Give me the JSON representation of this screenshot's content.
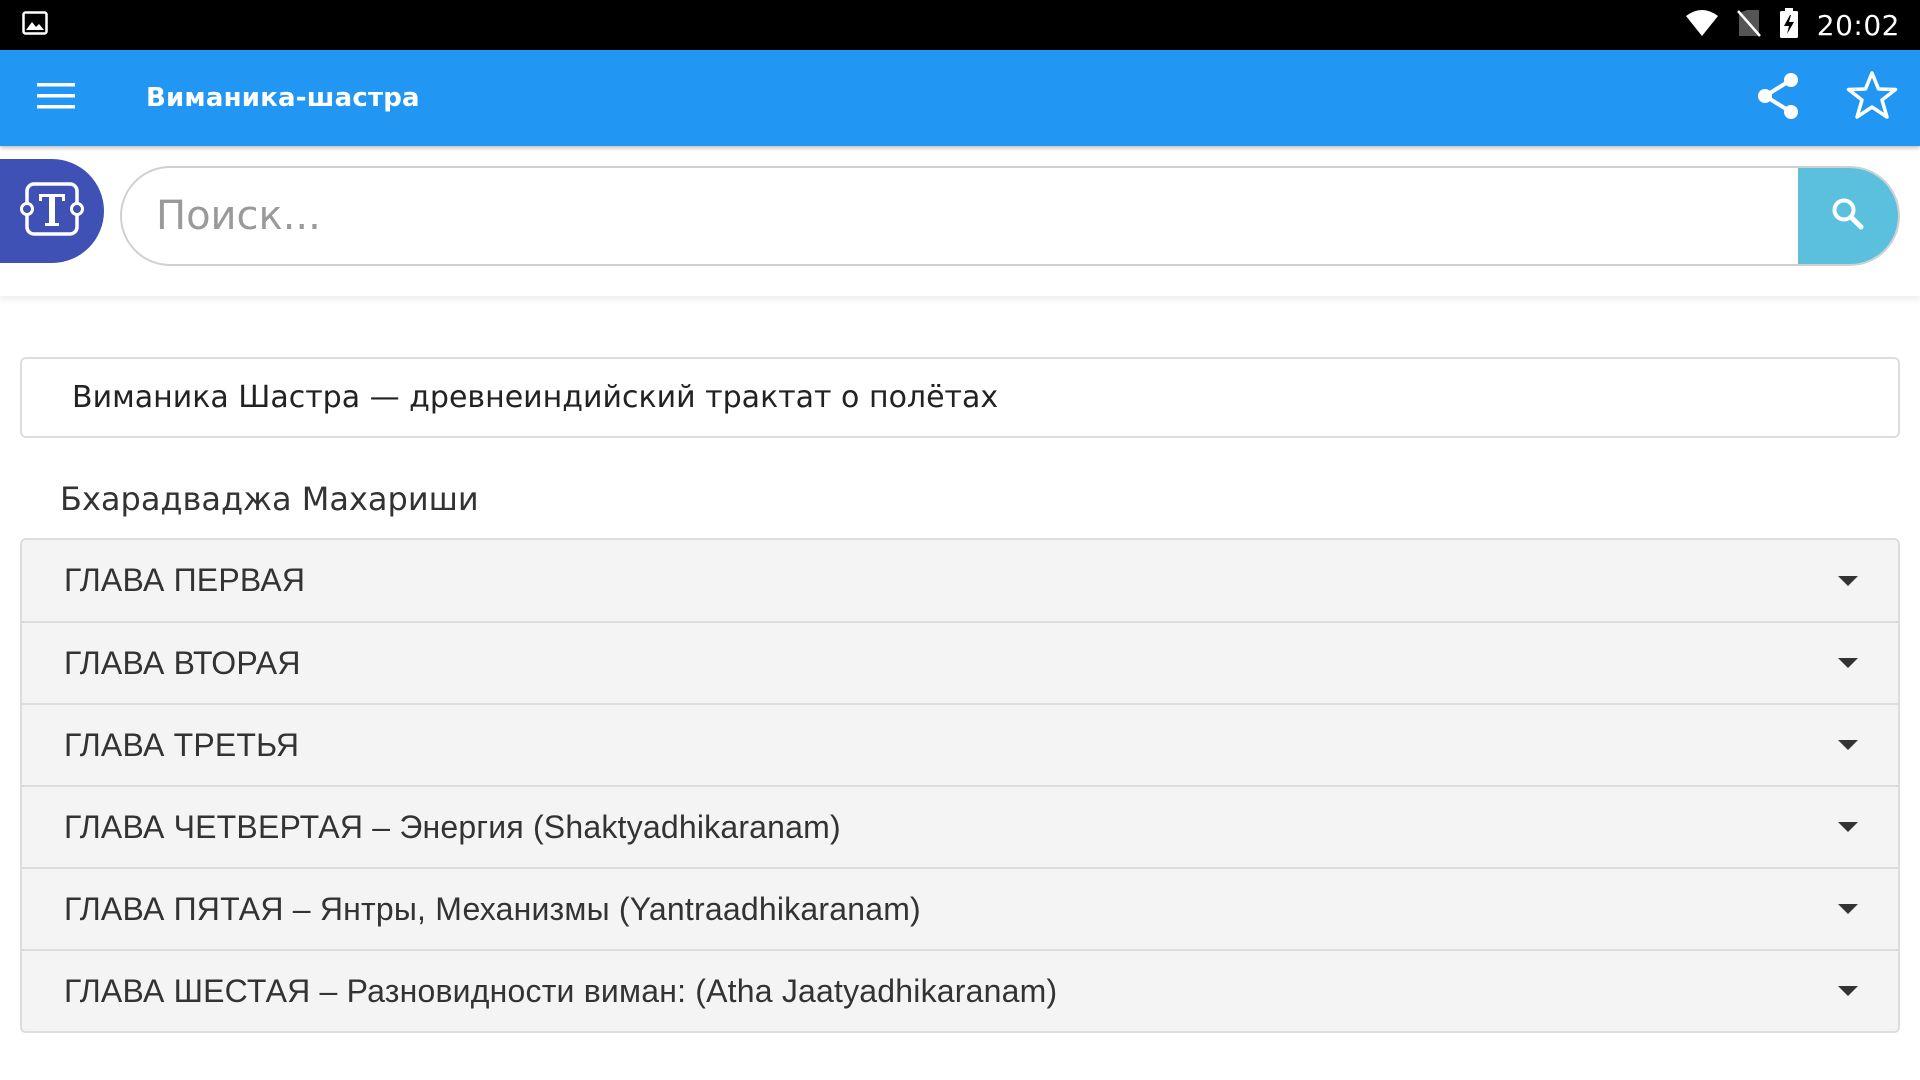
{
  "status_bar": {
    "time": "20:02",
    "icons": [
      "image-icon",
      "wifi-icon",
      "no-sim-icon",
      "battery-charging-icon"
    ]
  },
  "app_bar": {
    "title": "Виманика-шастра",
    "icons": [
      "menu-icon",
      "share-icon",
      "star-icon"
    ],
    "color": "#2196f3"
  },
  "search": {
    "placeholder": "Поиск...",
    "value": "",
    "button_color": "#5bc0de",
    "logo_color": "#3f51b5",
    "logo_icon": "text-tool-icon"
  },
  "content": {
    "heading": "Виманика Шастра — древнеиндийский трактат о полётах",
    "author": "Бхарадваджа Махариши",
    "chapters": [
      {
        "label": "ГЛАВА ПЕРВАЯ"
      },
      {
        "label": "ГЛАВА ВТОРАЯ"
      },
      {
        "label": "ГЛАВА ТРЕТЬЯ"
      },
      {
        "label": "ГЛАВА ЧЕТВЕРТАЯ – Энергия (Shaktyadhikaranam)"
      },
      {
        "label": "ГЛАВА ПЯТАЯ – Янтры, Механизмы (Yantraadhikaranam)"
      },
      {
        "label": "ГЛАВА ШЕСТАЯ – Разновидности виман: (Atha Jaatyadhikaranam)"
      }
    ]
  }
}
